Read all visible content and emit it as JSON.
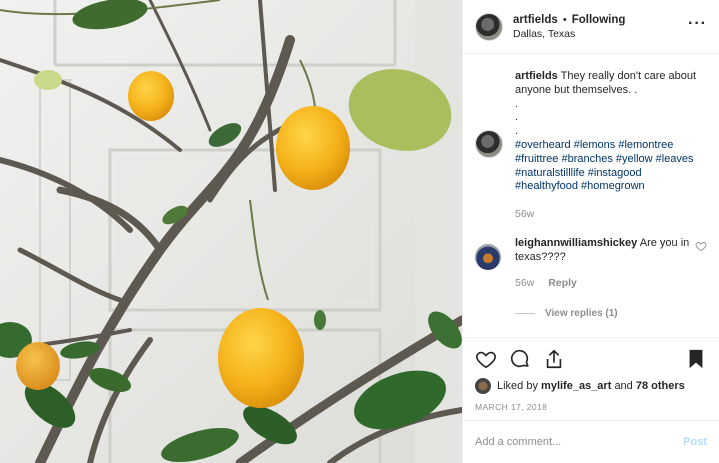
{
  "header": {
    "username": "artfields",
    "separator": "•",
    "follow_status": "Following",
    "location": "Dallas, Texas",
    "more_icon": "more-horizontal-icon",
    "more_label": "···"
  },
  "caption": {
    "username": "artfields",
    "text": "They really don't care about anyone but themselves. .",
    "dots": [
      ".",
      ".",
      "."
    ],
    "hashtags": "#overheard #lemons #lemontree #fruittree #branches #yellow #leaves #naturalstilllife #instagood #healthyfood #homegrown",
    "age": "56w"
  },
  "comment": {
    "username": "leighannwilliamshickey",
    "text": "Are you in texas????",
    "age": "56w",
    "reply_label": "Reply",
    "like_icon": "heart-outline-icon",
    "view_replies": "View replies (1)"
  },
  "actions": {
    "like_icon": "heart-outline-icon",
    "comment_icon": "comment-bubble-icon",
    "share_icon": "share-icon",
    "save_icon": "bookmark-filled-icon"
  },
  "likes": {
    "prefix": "Liked by",
    "user": "mylife_as_art",
    "middle": "and",
    "others": "78 others"
  },
  "date": "MARCH 17, 2018",
  "add_comment": {
    "placeholder": "Add a comment...",
    "post_label": "Post"
  },
  "colors": {
    "hashtag": "#003569",
    "muted": "#8e8e8e",
    "post_disabled": "#b2dffc",
    "lemon": "#f5b21a"
  }
}
